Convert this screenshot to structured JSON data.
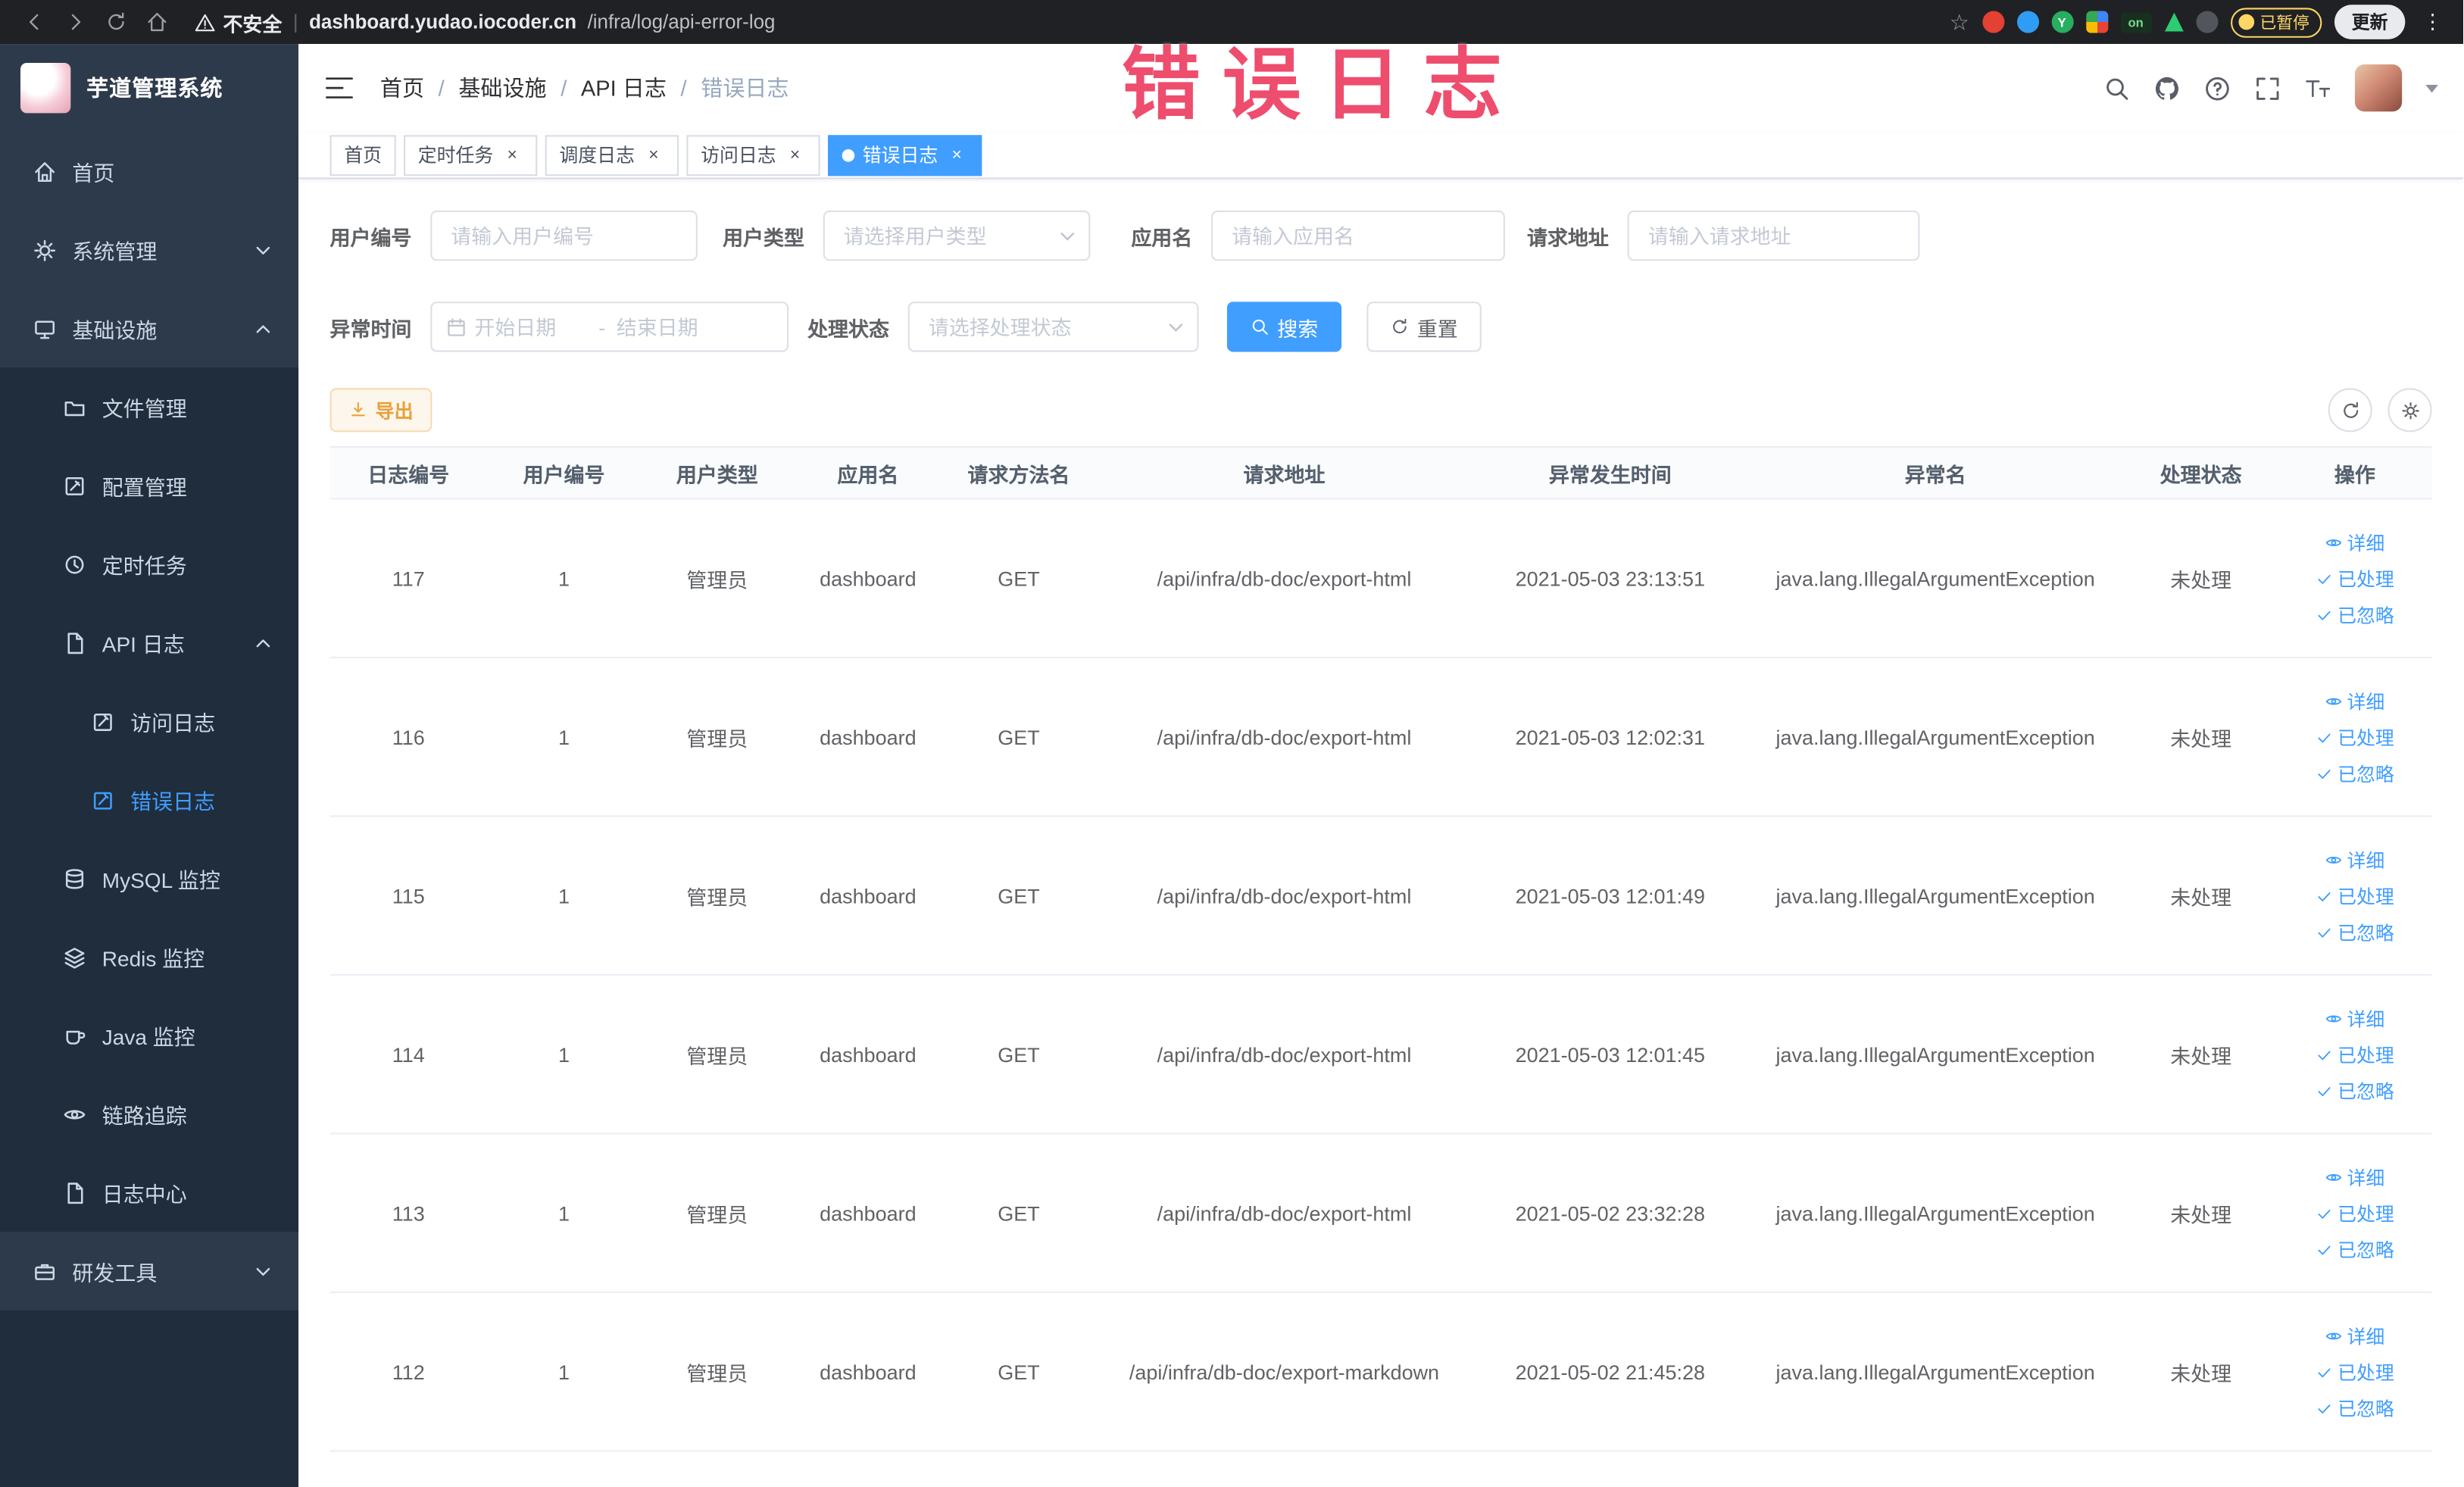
{
  "theme": {
    "accent": "#409eff",
    "warning": "#e6a23c",
    "annotation_pink": "#ee4d6e",
    "sidebar_bg": "#2d3a4b",
    "sidebar_submenu_bg": "#1f2d3d",
    "browser_bg": "#202124"
  },
  "annotation": {
    "label": "错误日志"
  },
  "browser": {
    "security": "不安全",
    "url_domain": "dashboard.yudao.iocoder.cn",
    "url_path": "/infra/log/api-error-log",
    "bookmark_star": "☆",
    "ext_y": "Y",
    "ext_on": "on",
    "paused_badge": "已暂停",
    "update_label": "更新",
    "menu_dots": "⋮"
  },
  "sidebar": {
    "title": "芋道管理系统",
    "items": [
      {
        "label": "首页"
      },
      {
        "label": "系统管理"
      },
      {
        "label": "基础设施"
      },
      {
        "label": "文件管理"
      },
      {
        "label": "配置管理"
      },
      {
        "label": "定时任务"
      },
      {
        "label": "API 日志"
      },
      {
        "label": "访问日志"
      },
      {
        "label": "错误日志"
      },
      {
        "label": "MySQL 监控"
      },
      {
        "label": "Redis 监控"
      },
      {
        "label": "Java 监控"
      },
      {
        "label": "链路追踪"
      },
      {
        "label": "日志中心"
      },
      {
        "label": "研发工具"
      }
    ]
  },
  "navbar": {
    "separator": "/",
    "breadcrumb": [
      "首页",
      "基础设施",
      "API 日志",
      "错误日志"
    ]
  },
  "tabs": [
    {
      "label": "首页"
    },
    {
      "label": "定时任务"
    },
    {
      "label": "调度日志"
    },
    {
      "label": "访问日志"
    },
    {
      "label": "错误日志"
    }
  ],
  "ui": {
    "close": "×"
  },
  "filters": {
    "user_id": {
      "label": "用户编号",
      "placeholder": "请输入用户编号"
    },
    "user_type": {
      "label": "用户类型",
      "placeholder": "请选择用户类型"
    },
    "app_name": {
      "label": "应用名",
      "placeholder": "请输入应用名"
    },
    "request_url": {
      "label": "请求地址",
      "placeholder": "请输入请求地址"
    },
    "exception_time": {
      "label": "异常时间",
      "start_placeholder": "开始日期",
      "separator": "-",
      "end_placeholder": "结束日期"
    },
    "process_status": {
      "label": "处理状态",
      "placeholder": "请选择处理状态"
    },
    "search_button": "搜索",
    "reset_button": "重置"
  },
  "toolbar": {
    "export_button": "导出"
  },
  "table": {
    "headers": [
      "日志编号",
      "用户编号",
      "用户类型",
      "应用名",
      "请求方法名",
      "请求地址",
      "异常发生时间",
      "异常名",
      "处理状态",
      "操作"
    ],
    "actions": [
      "详细",
      "已处理",
      "已忽略"
    ],
    "rows": [
      {
        "id": "117",
        "user_id": "1",
        "user_type": "管理员",
        "app": "dashboard",
        "method": "GET",
        "url": "/api/infra/db-doc/export-html",
        "time": "2021-05-03 23:13:51",
        "exception": "java.lang.IllegalArgumentException",
        "status": "未处理"
      },
      {
        "id": "116",
        "user_id": "1",
        "user_type": "管理员",
        "app": "dashboard",
        "method": "GET",
        "url": "/api/infra/db-doc/export-html",
        "time": "2021-05-03 12:02:31",
        "exception": "java.lang.IllegalArgumentException",
        "status": "未处理"
      },
      {
        "id": "115",
        "user_id": "1",
        "user_type": "管理员",
        "app": "dashboard",
        "method": "GET",
        "url": "/api/infra/db-doc/export-html",
        "time": "2021-05-03 12:01:49",
        "exception": "java.lang.IllegalArgumentException",
        "status": "未处理"
      },
      {
        "id": "114",
        "user_id": "1",
        "user_type": "管理员",
        "app": "dashboard",
        "method": "GET",
        "url": "/api/infra/db-doc/export-html",
        "time": "2021-05-03 12:01:45",
        "exception": "java.lang.IllegalArgumentException",
        "status": "未处理"
      },
      {
        "id": "113",
        "user_id": "1",
        "user_type": "管理员",
        "app": "dashboard",
        "method": "GET",
        "url": "/api/infra/db-doc/export-html",
        "time": "2021-05-02 23:32:28",
        "exception": "java.lang.IllegalArgumentException",
        "status": "未处理"
      },
      {
        "id": "112",
        "user_id": "1",
        "user_type": "管理员",
        "app": "dashboard",
        "method": "GET",
        "url": "/api/infra/db-doc/export-markdown",
        "time": "2021-05-02 21:45:28",
        "exception": "java.lang.IllegalArgumentException",
        "status": "未处理"
      }
    ]
  }
}
